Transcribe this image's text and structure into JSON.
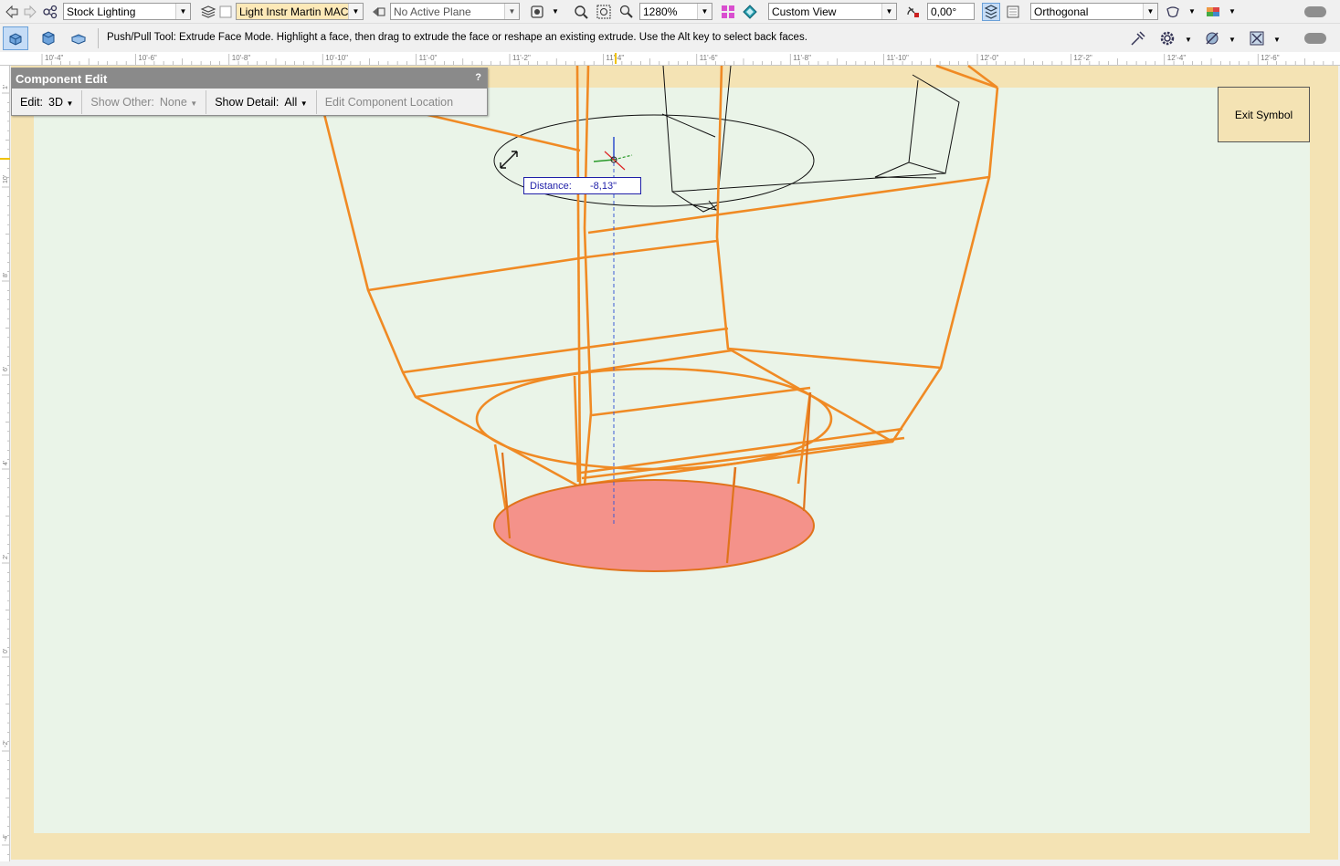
{
  "toolbar": {
    "class_select": "Stock Lighting",
    "layer_select": "Light Instr Martin MAC Vi",
    "plane_select": "No Active Plane",
    "zoom_select": "1280%",
    "view_select": "Custom View",
    "rotation_field": "0,00°",
    "projection_select": "Orthogonal"
  },
  "mode_bar": {
    "hint": "Push/Pull Tool: Extrude Face Mode. Highlight a face, then drag to extrude the face or reshape an existing extrude. Use the Alt key to select back faces."
  },
  "ruler": {
    "h_ticks": [
      "10'-4\"",
      "10'-6\"",
      "10'-8\"",
      "10'-10\"",
      "11'-0\"",
      "11'-2\"",
      "11'-4\"",
      "11'-6\"",
      "11'-8\"",
      "11'-10\"",
      "12'-0\"",
      "12'-2\"",
      "12'-4\"",
      "12'-6\""
    ],
    "v_ticks": [
      "1'",
      "10'",
      "8'",
      "6'",
      "4'",
      "2'",
      "0'",
      "-2'",
      "-4'"
    ]
  },
  "component_edit": {
    "title": "Component Edit",
    "help": "?",
    "edit_label": "Edit:",
    "edit_value": "3D",
    "show_other_label": "Show Other:",
    "show_other_value": "None",
    "show_detail_label": "Show Detail:",
    "show_detail_value": "All",
    "location_button": "Edit Component Location"
  },
  "exit_symbol": "Exit Symbol",
  "distance": {
    "label": "Distance:",
    "value": "-8,13\""
  },
  "colors": {
    "wire_selected": "#f08a24",
    "face_highlight": "#f4928a",
    "canvas": "#eaf4e8",
    "page_border": "#f4e3b4"
  }
}
